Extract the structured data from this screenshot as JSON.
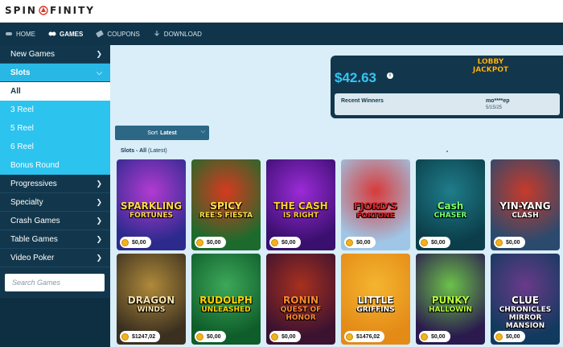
{
  "brand": {
    "logo_text_left": "SPIN",
    "logo_text_right": "FINITY"
  },
  "nav": {
    "items": [
      {
        "label": "HOME",
        "icon": "gamepad-icon",
        "active": false
      },
      {
        "label": "GAMES",
        "icon": "games-icon",
        "active": true
      },
      {
        "label": "COUPONS",
        "icon": "coupon-icon",
        "active": false
      },
      {
        "label": "DOWNLOAD",
        "icon": "download-icon",
        "active": false
      }
    ]
  },
  "sidebar": {
    "items": [
      {
        "label": "New Games"
      },
      {
        "label": "Slots"
      },
      {
        "label": "Progressives"
      },
      {
        "label": "Specialty"
      },
      {
        "label": "Crash Games"
      },
      {
        "label": "Table Games"
      },
      {
        "label": "Video Poker"
      }
    ],
    "slots_sub": [
      {
        "label": "All"
      },
      {
        "label": "3 Reel"
      },
      {
        "label": "5 Reel"
      },
      {
        "label": "6 Reel"
      },
      {
        "label": "Bonus Round"
      }
    ],
    "search_placeholder": "Search Games"
  },
  "jackpot": {
    "amount": "$42.63",
    "info_symbol": "i",
    "logo_line1": "LOBBY",
    "logo_line2": "JACKPOT",
    "recent_winners_label": "Recent Winners",
    "winner_name": "mo****ep",
    "winner_date": "5/15/25"
  },
  "sort": {
    "prefix": "Sort",
    "value": "Latest"
  },
  "section": {
    "category": "Slots",
    "separator": " - ",
    "filter": "All",
    "sort_note": "(Latest)"
  },
  "games": [
    {
      "title": "SPARKLING",
      "subtitle": "FORTUNES",
      "price": "$0,00",
      "bg1": "#2d2a8e",
      "bg2": "#b23bd1",
      "color": "#ffd84a"
    },
    {
      "title": "SPICY",
      "subtitle": "REE'S FIESTA",
      "price": "$0,00",
      "bg1": "#1c6b2c",
      "bg2": "#d63a1f",
      "color": "#ffe14a"
    },
    {
      "title": "THE CASH",
      "subtitle": "IS RIGHT",
      "price": "$0,00",
      "bg1": "#3a0f6e",
      "bg2": "#9b2bd8",
      "color": "#ffcf2e"
    },
    {
      "title": "FJORD'S",
      "subtitle": "FORTUNE",
      "price": "$0,00",
      "bg1": "#9fc6e6",
      "bg2": "#d83a3a",
      "color": "#d8262a"
    },
    {
      "title": "Cash",
      "subtitle": "CHASER",
      "price": "$0,00",
      "bg1": "#0b3e4a",
      "bg2": "#1f7d8a",
      "color": "#7dff6a"
    },
    {
      "title": "YIN-YANG",
      "subtitle": "CLASH",
      "price": "$0,00",
      "bg1": "#2a4a6e",
      "bg2": "#c83a2a",
      "color": "#ffffff"
    },
    {
      "title": "DRAGON",
      "subtitle": "WINDS",
      "price": "$1247,02",
      "bg1": "#3b3020",
      "bg2": "#b08a3a",
      "color": "#f5e3b0"
    },
    {
      "title": "RUDOLPH",
      "subtitle": "UNLEASHED",
      "price": "$0,00",
      "bg1": "#0e5d2a",
      "bg2": "#3da85a",
      "color": "#ffd400"
    },
    {
      "title": "RONIN",
      "subtitle": "QUEST OF HONOR",
      "price": "$0,00",
      "bg1": "#3b1230",
      "bg2": "#a8301e",
      "color": "#ff8a2e"
    },
    {
      "title": "LITTLE",
      "subtitle": "GRIFFINS",
      "price": "$1476,02",
      "bg1": "#e48a17",
      "bg2": "#f4b52f",
      "color": "#ffffff"
    },
    {
      "title": "PUNKY",
      "subtitle": "HALLOWIN",
      "price": "$0,00",
      "bg1": "#2a1a4e",
      "bg2": "#6cc24a",
      "color": "#b8ff3a"
    },
    {
      "title": "CLUE",
      "subtitle": "CHRONICLES MIRROR MANSION",
      "price": "$0,00",
      "bg1": "#123a5e",
      "bg2": "#6a3a8a",
      "color": "#ffffff"
    }
  ]
}
